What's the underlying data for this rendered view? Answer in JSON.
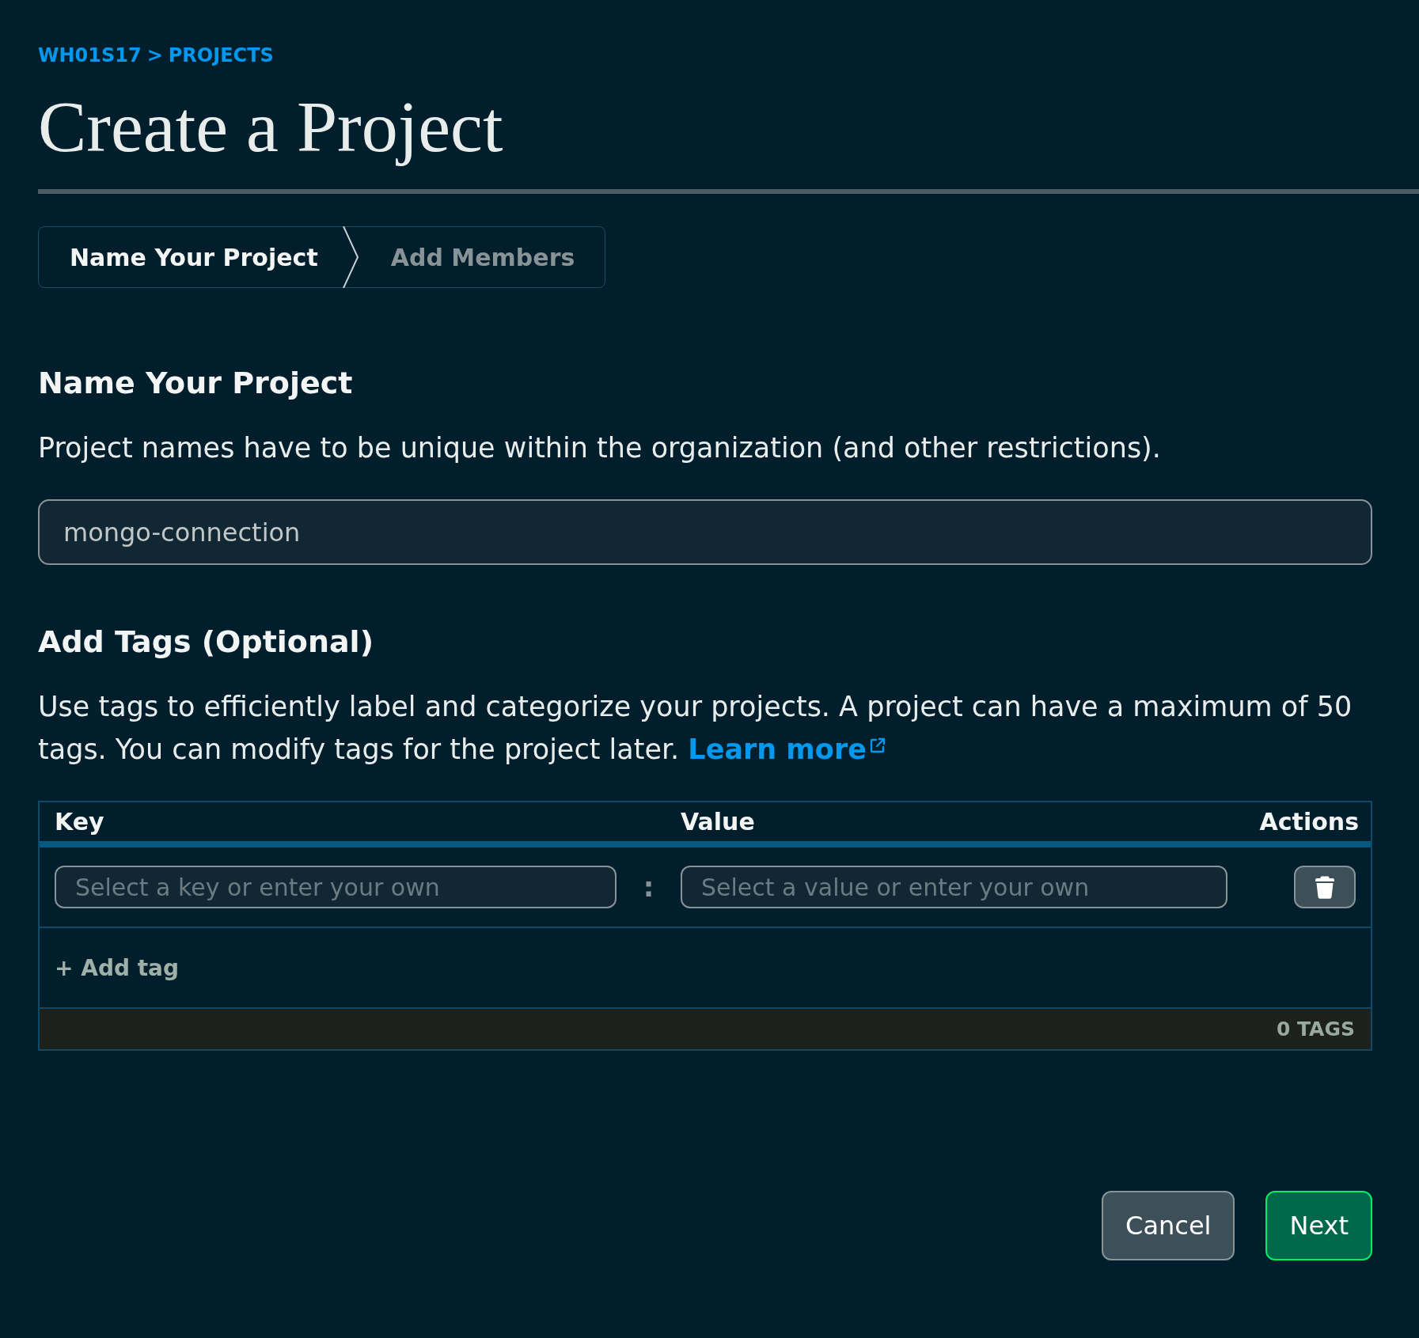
{
  "breadcrumb": {
    "items": [
      {
        "label": "WH01S17"
      },
      {
        "label": "PROJECTS"
      }
    ],
    "separator": ">"
  },
  "page_title": "Create a Project",
  "stepper": [
    {
      "label": "Name Your Project",
      "selected": true
    },
    {
      "label": "Add Members",
      "selected": false
    }
  ],
  "name_section": {
    "heading": "Name Your Project",
    "description": "Project names have to be unique within the organization (and other restrictions).",
    "project_name": {
      "value": "mongo-connection"
    }
  },
  "tags_section": {
    "heading": "Add Tags (Optional)",
    "description": "Use tags to efficiently label and categorize your projects. A project can have a maximum of 50 tags. You can modify tags for the project later.",
    "learn_more": "Learn more",
    "table": {
      "columns": [
        "Key",
        "Value",
        "Actions"
      ],
      "rows": [
        {
          "key": {
            "placeholder": "Select a key or enter your own"
          },
          "separator": ":",
          "value": {
            "placeholder": "Select a value or enter your own"
          }
        }
      ],
      "add_tag": "+ Add tag",
      "count": "0 TAGS"
    }
  },
  "buttons": [
    {
      "label": "Cancel",
      "kind": "secondary"
    },
    {
      "label": "Next",
      "kind": "primary"
    }
  ]
}
